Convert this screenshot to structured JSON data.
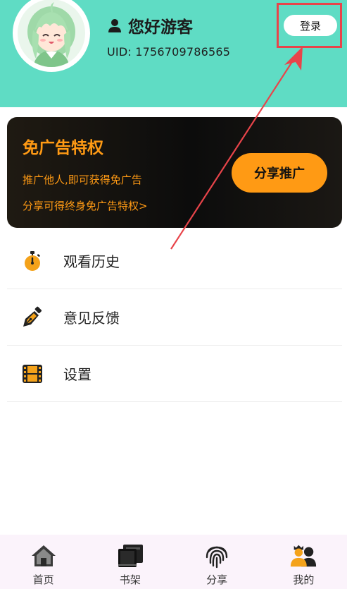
{
  "header": {
    "greeting": "您好游客",
    "uid": "UID: 1756709786565",
    "login_label": "登录",
    "background_color": "#5fdcc4"
  },
  "ad_card": {
    "title": "免广告特权",
    "line1": "推广他人,即可获得免广告",
    "line2": "分享可得终身免广告特权>",
    "share_label": "分享推广",
    "accent_color": "#ff9a14"
  },
  "menu": {
    "items": [
      {
        "label": "观看历史",
        "icon": "stopwatch-icon"
      },
      {
        "label": "意见反馈",
        "icon": "pen-nib-icon"
      },
      {
        "label": "设置",
        "icon": "film-icon"
      }
    ]
  },
  "bottom_nav": {
    "items": [
      {
        "label": "首页",
        "icon": "home-icon"
      },
      {
        "label": "书架",
        "icon": "bookshelf-icon"
      },
      {
        "label": "分享",
        "icon": "fingerprint-icon"
      },
      {
        "label": "我的",
        "icon": "profile-icon"
      }
    ]
  },
  "annotation": {
    "color": "#e8444a"
  }
}
